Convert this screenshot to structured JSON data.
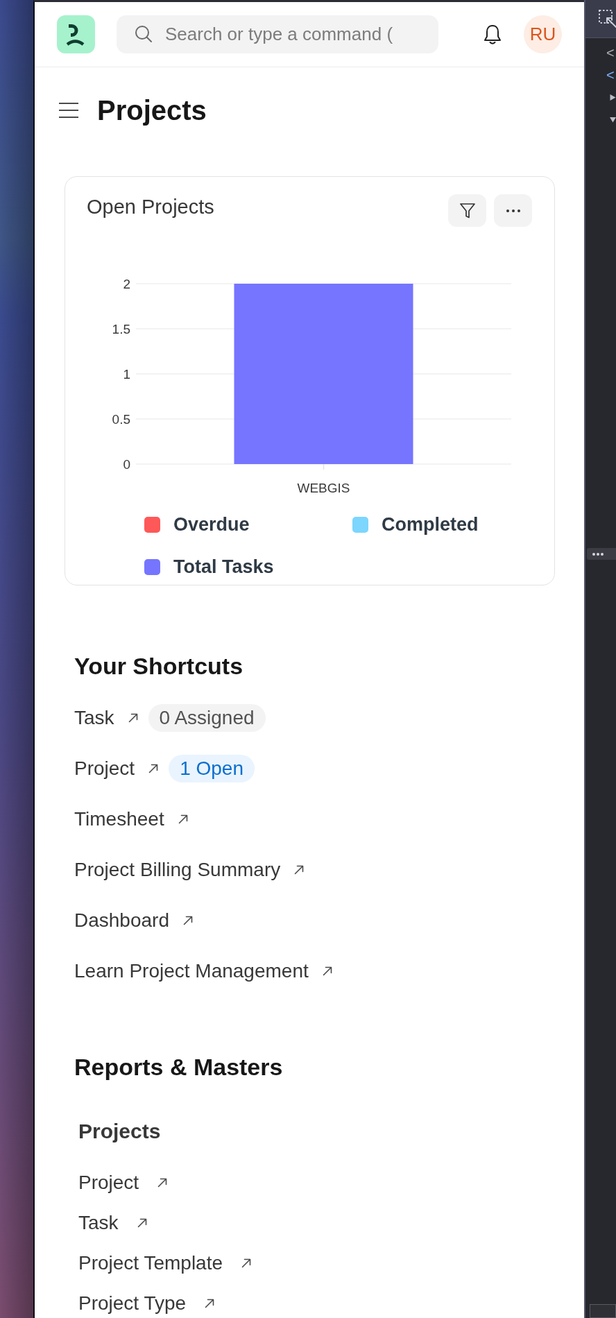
{
  "header": {
    "search": {
      "placeholder": "Search or type a command ("
    },
    "avatar": {
      "initials": "RU"
    }
  },
  "page": {
    "title": "Projects"
  },
  "chart_card": {
    "title": "Open Projects",
    "chart_data": {
      "type": "bar",
      "categories": [
        "WEBGIS"
      ],
      "series": [
        {
          "name": "Overdue",
          "color": "#ff5858",
          "values": [
            0
          ]
        },
        {
          "name": "Completed",
          "color": "#7cd6fd",
          "values": [
            0
          ]
        },
        {
          "name": "Total Tasks",
          "color": "#7575ff",
          "values": [
            2
          ]
        }
      ],
      "ylim": [
        0,
        2
      ],
      "yticks": [
        0,
        0.5,
        1,
        1.5,
        2
      ],
      "stacked": true,
      "grid": true
    }
  },
  "shortcuts": {
    "title": "Your Shortcuts",
    "items": [
      {
        "label": "Task",
        "badge": {
          "text": "0 Assigned",
          "kind": "neutral"
        }
      },
      {
        "label": "Project",
        "badge": {
          "text": "1 Open",
          "kind": "info"
        }
      },
      {
        "label": "Timesheet"
      },
      {
        "label": "Project Billing Summary"
      },
      {
        "label": "Dashboard"
      },
      {
        "label": "Learn Project Management"
      }
    ]
  },
  "reports": {
    "title": "Reports & Masters",
    "groups": [
      {
        "title": "Projects",
        "links": [
          {
            "label": "Project"
          },
          {
            "label": "Task"
          },
          {
            "label": "Project Template"
          },
          {
            "label": "Project Type"
          }
        ]
      }
    ]
  },
  "devtools": {
    "code": [
      {
        "text": "<",
        "color": "#a8acb3"
      },
      {
        "text": "<",
        "color": "#7cacf8"
      }
    ],
    "tree": [
      {
        "expanded": false
      },
      {
        "expanded": true
      }
    ]
  }
}
